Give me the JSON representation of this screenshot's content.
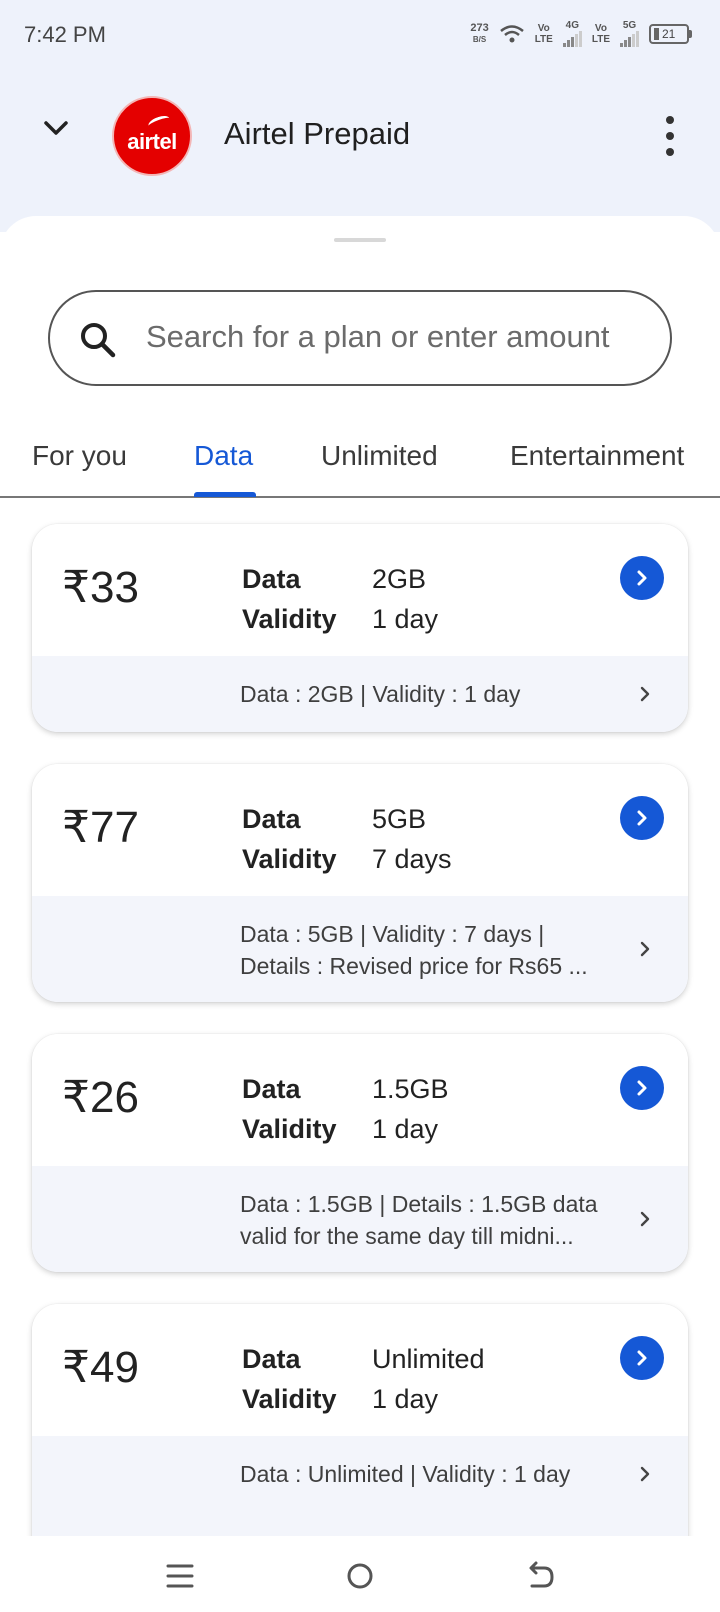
{
  "status_bar": {
    "time": "7:42 PM",
    "net_speed_value": "273",
    "net_speed_unit": "B/S",
    "sim1_top": "Vo",
    "sim1_bottom": "LTE",
    "sim1_gen": "4G",
    "sim2_top": "Vo",
    "sim2_bottom": "LTE",
    "sim2_gen": "5G",
    "battery": "21"
  },
  "header": {
    "title": "Airtel Prepaid",
    "logo_text": "airtel"
  },
  "search": {
    "placeholder": "Search for a plan or enter amount"
  },
  "tabs": [
    {
      "label": "For you",
      "active": false
    },
    {
      "label": "Data",
      "active": true
    },
    {
      "label": "Unlimited",
      "active": false
    },
    {
      "label": "Entertainment",
      "active": false
    }
  ],
  "plans": [
    {
      "price": "₹33",
      "data_label": "Data",
      "data_value": "2GB",
      "validity_label": "Validity",
      "validity_value": "1 day",
      "details_line1": "Data :  2GB | Validity :  1 day",
      "details_line2": ""
    },
    {
      "price": "₹77",
      "data_label": "Data",
      "data_value": "5GB",
      "validity_label": "Validity",
      "validity_value": "7 days",
      "details_line1": "Data :  5GB | Validity :  7 days |",
      "details_line2": "Details : Revised price for Rs65 ..."
    },
    {
      "price": "₹26",
      "data_label": "Data",
      "data_value": "1.5GB",
      "validity_label": "Validity",
      "validity_value": "1 day",
      "details_line1": "Data : 1.5GB | Details : 1.5GB data",
      "details_line2": "valid for the same day till midni..."
    },
    {
      "price": "₹49",
      "data_label": "Data",
      "data_value": "Unlimited",
      "validity_label": "Validity",
      "validity_value": "1 day",
      "details_line1": "Data : Unlimited | Validity :  1 day",
      "details_line2": ""
    }
  ],
  "colors": {
    "accent": "#1558d6",
    "header_bg": "#eef2fb",
    "brand_red": "#e40000",
    "card_footer_bg": "#f3f5fb"
  },
  "icons": {
    "back": "chevron-down-icon",
    "menu": "more-vert-icon",
    "search": "search-icon",
    "plan_go": "chevron-right-circle-icon",
    "details_go": "chevron-right-icon",
    "nav_recents": "menu-icon",
    "nav_home": "home-circle-icon",
    "nav_back": "back-icon"
  }
}
